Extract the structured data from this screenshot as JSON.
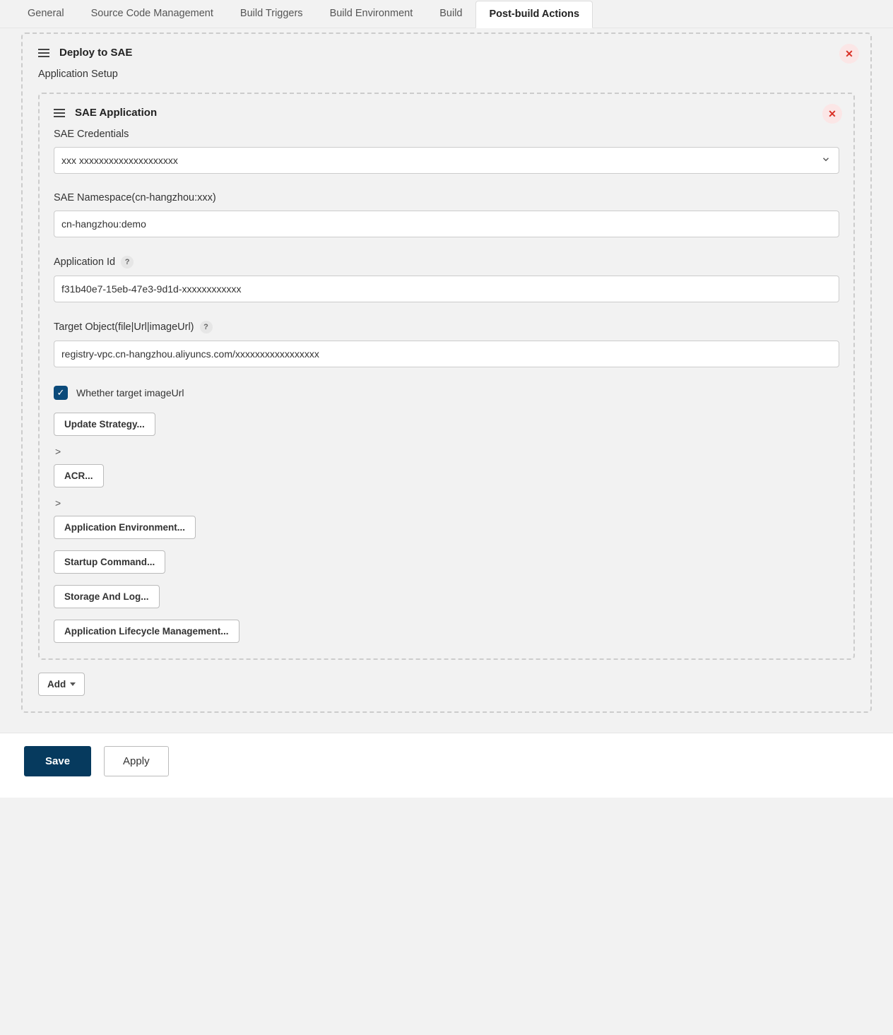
{
  "tabs": [
    {
      "label": "General"
    },
    {
      "label": "Source Code Management"
    },
    {
      "label": "Build Triggers"
    },
    {
      "label": "Build Environment"
    },
    {
      "label": "Build"
    },
    {
      "label": "Post-build Actions"
    }
  ],
  "section": {
    "title": "Deploy to SAE",
    "sub_label": "Application Setup",
    "close_icon": "✕"
  },
  "inner": {
    "title": "SAE Application",
    "close_icon": "✕",
    "credentials_label": "SAE Credentials",
    "credentials_value": "xxx xxxxxxxxxxxxxxxxxxxx",
    "namespace_label": "SAE Namespace(cn-hangzhou:xxx)",
    "namespace_value": "cn-hangzhou:demo",
    "appid_label": "Application Id",
    "appid_value": "f31b40e7-15eb-47e3-9d1d-xxxxxxxxxxxx",
    "target_label": "Target Object(file|Url|imageUrl)",
    "target_value": "registry-vpc.cn-hangzhou.aliyuncs.com/xxxxxxxxxxxxxxxxx",
    "checkbox_label": "Whether target imageUrl",
    "buttons": {
      "update_strategy": "Update Strategy...",
      "acr": "ACR...",
      "app_env": "Application Environment...",
      "startup_cmd": "Startup Command...",
      "storage_log": "Storage And Log...",
      "alm": "Application Lifecycle Management..."
    }
  },
  "footer": {
    "add_label": "Add"
  },
  "actions": {
    "save": "Save",
    "apply": "Apply"
  }
}
